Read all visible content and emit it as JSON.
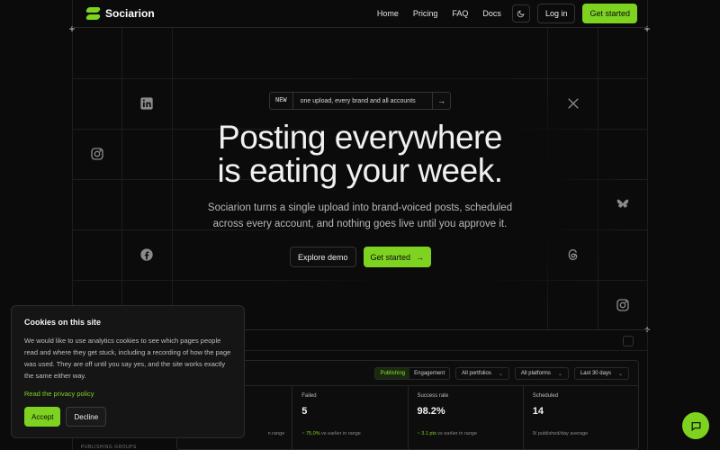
{
  "brand": {
    "name": "Sociarion",
    "accent": "#7ed321"
  },
  "nav": {
    "links": [
      "Home",
      "Pricing",
      "FAQ",
      "Docs"
    ],
    "theme_icon": "moon-icon",
    "login_label": "Log in",
    "cta_label": "Get started"
  },
  "hero": {
    "badge_tag": "NEW",
    "badge_text": "one upload, every brand and all accounts",
    "headline_line1": "Posting everywhere",
    "headline_line2": "is eating your week.",
    "subline": "Sociarion turns a single upload into brand-voiced posts, scheduled across every account, and nothing goes live until you approve it.",
    "secondary_cta": "Explore demo",
    "primary_cta": "Get started"
  },
  "social_icons": [
    "linkedin-icon",
    "instagram-icon",
    "facebook-icon",
    "x-icon",
    "bluesky-icon",
    "threads-icon",
    "instagram-icon"
  ],
  "dashboard": {
    "tabs": [
      {
        "label": "Publishing",
        "active": true
      },
      {
        "label": "Engagement",
        "active": false
      }
    ],
    "filters": [
      "All portfolios",
      "All platforms",
      "Last 30 days"
    ],
    "cards": [
      {
        "label": "",
        "value": "",
        "foot_delta": "",
        "foot_text": "n range"
      },
      {
        "label": "Failed",
        "value": "5",
        "foot_delta": "~ 75.0%",
        "foot_text": "vs earlier in range"
      },
      {
        "label": "Success rate",
        "value": "98.2%",
        "foot_delta": "~ 3.1 pts",
        "foot_text": "vs earlier in range"
      },
      {
        "label": "Scheduled",
        "value": "14",
        "foot_delta": "",
        "foot_text": "9/ published/day average"
      }
    ],
    "side_label": "PUBLISHING GROUPS"
  },
  "cookie": {
    "title": "Cookies on this site",
    "body": "We would like to use analytics cookies to see which pages people read and where they get stuck, including a recording of how the page was used. They are off until you say yes, and the site works exactly the same either way.",
    "link": "Read the privacy policy",
    "accept": "Accept",
    "decline": "Decline"
  },
  "chat_icon": "chat-bubble-icon"
}
